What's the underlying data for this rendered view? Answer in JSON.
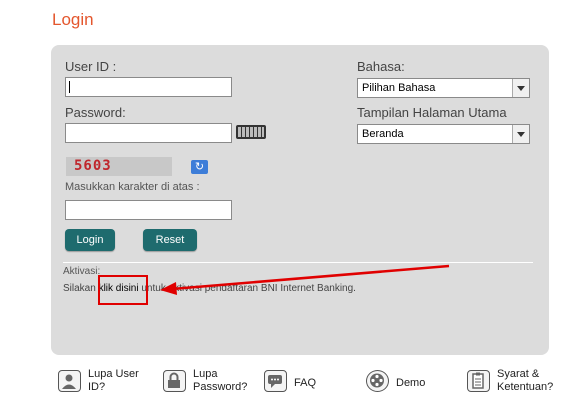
{
  "title": "Login",
  "form": {
    "userid_label": "User ID :",
    "password_label": "Password:",
    "captcha_code": "5603",
    "captcha_hint": "Masukkan karakter di atas :",
    "login_button": "Login",
    "reset_button": "Reset"
  },
  "settings": {
    "language_label": "Bahasa:",
    "language_value": "Pilihan Bahasa",
    "homepage_label": "Tampilan Halaman Utama",
    "homepage_value": "Beranda"
  },
  "activation": {
    "heading": "Aktivasi:",
    "text_before": "Silakan ",
    "link_text": "klik disini",
    "text_after": " untuk aktivasi pendaftaran BNI Internet Banking."
  },
  "footer": {
    "items": [
      {
        "label": "Lupa User\nID?",
        "icon": "user-icon"
      },
      {
        "label": "Lupa\nPassword?",
        "icon": "lock-icon"
      },
      {
        "label": "FAQ",
        "icon": "chat-icon"
      },
      {
        "label": "Demo",
        "icon": "film-reel-icon"
      },
      {
        "label": "Syarat &\nKetentuan?",
        "icon": "clipboard-icon"
      }
    ]
  },
  "colors": {
    "title": "#e4572e",
    "panel": "#dcdcdc",
    "button": "#1e6b6e",
    "annotation": "#e00000"
  }
}
